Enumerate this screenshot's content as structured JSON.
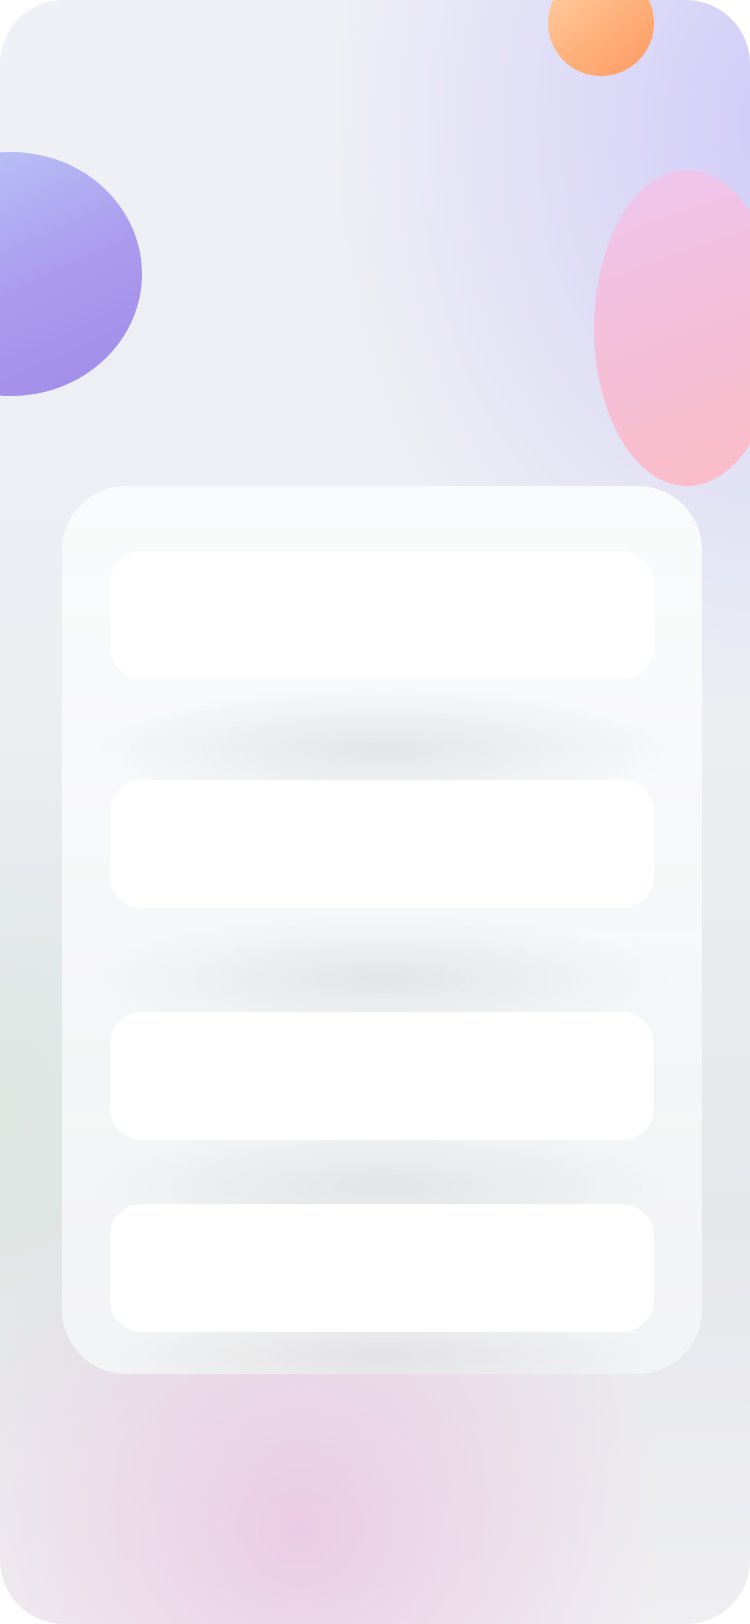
{
  "app": {
    "title": ""
  },
  "colors": {
    "background_top": "#eef0f6",
    "background_bottom": "#efeff2",
    "panel": "#f8f9fa",
    "card": "#ffffff",
    "orange_blob": "#fb9a64",
    "purple_blob": "#ab9bef",
    "pink_blob": "#f4bfda"
  },
  "panel": {
    "cards": [
      {
        "label": ""
      },
      {
        "label": ""
      },
      {
        "label": ""
      },
      {
        "label": ""
      }
    ]
  }
}
